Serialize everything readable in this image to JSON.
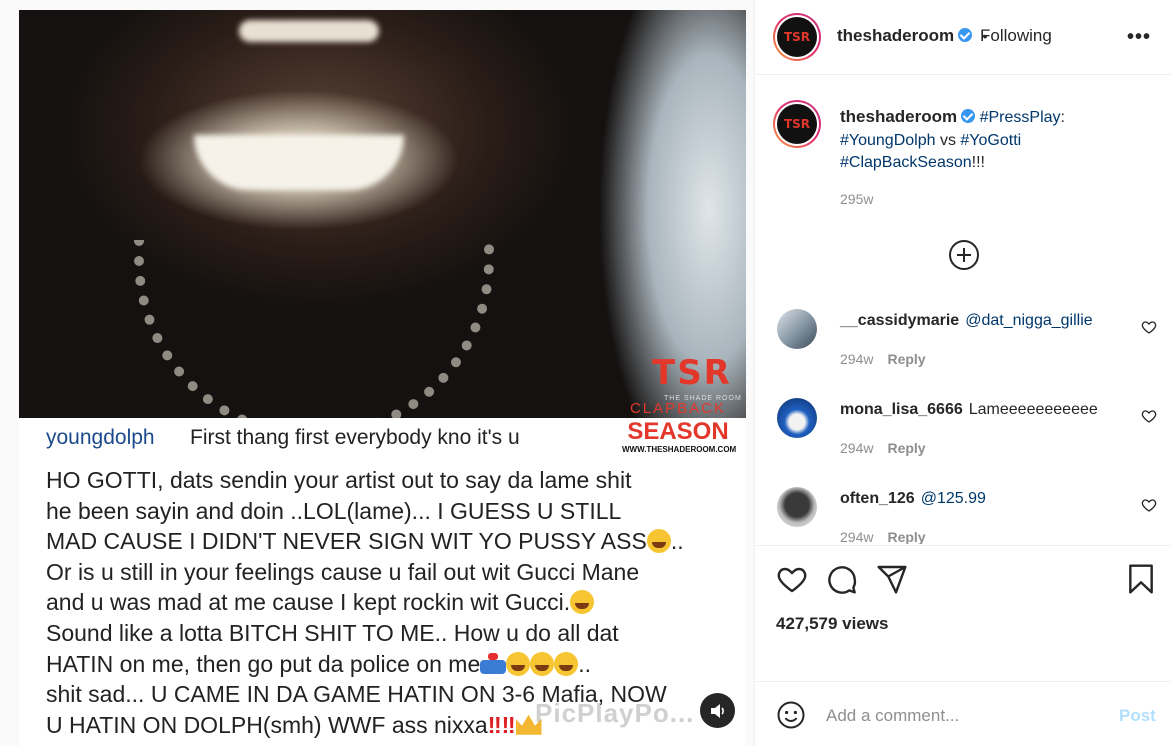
{
  "post_media": {
    "watermark_logo": "TSR",
    "logo_subtext": "THE SHADE ROOM",
    "clapback_line1": "CLAPBACK",
    "clapback_line2": "SEASON",
    "site": "WWW.THESHADEROOM.COM",
    "caption_user": "youngdolph",
    "caption_first": "First thang first everybody kno it's u",
    "caption_lines": [
      "HO GOTTI, dats sendin your artist out to say da lame shit",
      "he been sayin and doin ..LOL(lame)... I GUESS U STILL",
      "MAD CAUSE I DIDN'T NEVER SIGN WIT YO PUSSY ASS",
      "Or is u still in your feelings cause u fail out wit Gucci Mane",
      "and u was mad at me cause I kept rockin wit Gucci.",
      "Sound like a lotta BITCH SHIT TO ME.. How u do all dat",
      "HATIN on me, then go put da police on me",
      "shit sad... U CAME IN DA GAME HATIN ON 3-6 Mafia, NOW",
      "U HATIN ON DOLPH(smh) WWF ass nixxa"
    ],
    "line3_suffix": "..",
    "line7_suffix": "..",
    "bottom_watermark": "PicPlayPo..."
  },
  "header": {
    "username": "theshaderoom",
    "separator": "•",
    "follow_status": "Following",
    "more": "•••"
  },
  "post_caption": {
    "username": "theshaderoom",
    "tag_press": "#PressPlay",
    "colon": ":",
    "tag_dolph": "#YoungDolph",
    "vs": "vs",
    "tag_gotti": "#YoGotti",
    "tag_season": "#ClapBackSeason",
    "bang": "!!!",
    "time": "295w"
  },
  "comments": [
    {
      "user": "__cassidymarie",
      "text": "@dat_nigga_gillie",
      "time": "294w",
      "reply": "Reply"
    },
    {
      "user": "mona_lisa_6666",
      "text": "Lameeeeeeeeeee",
      "time": "294w",
      "reply": "Reply"
    },
    {
      "user": "often_126",
      "text": "@125.99",
      "time": "294w",
      "reply": "Reply"
    }
  ],
  "stats": {
    "views": "427,579 views"
  },
  "add_comment": {
    "placeholder": "Add a comment...",
    "post_label": "Post"
  },
  "colors": {
    "link": "#00376b",
    "verified": "#3897f0",
    "brand_red": "#e2372a",
    "post_disabled": "#b2dffc"
  },
  "icons": [
    "verified-icon",
    "more-options-icon",
    "load-more-icon",
    "heart-icon",
    "comment-icon",
    "share-icon",
    "bookmark-icon",
    "emoji-icon",
    "sound-icon"
  ]
}
